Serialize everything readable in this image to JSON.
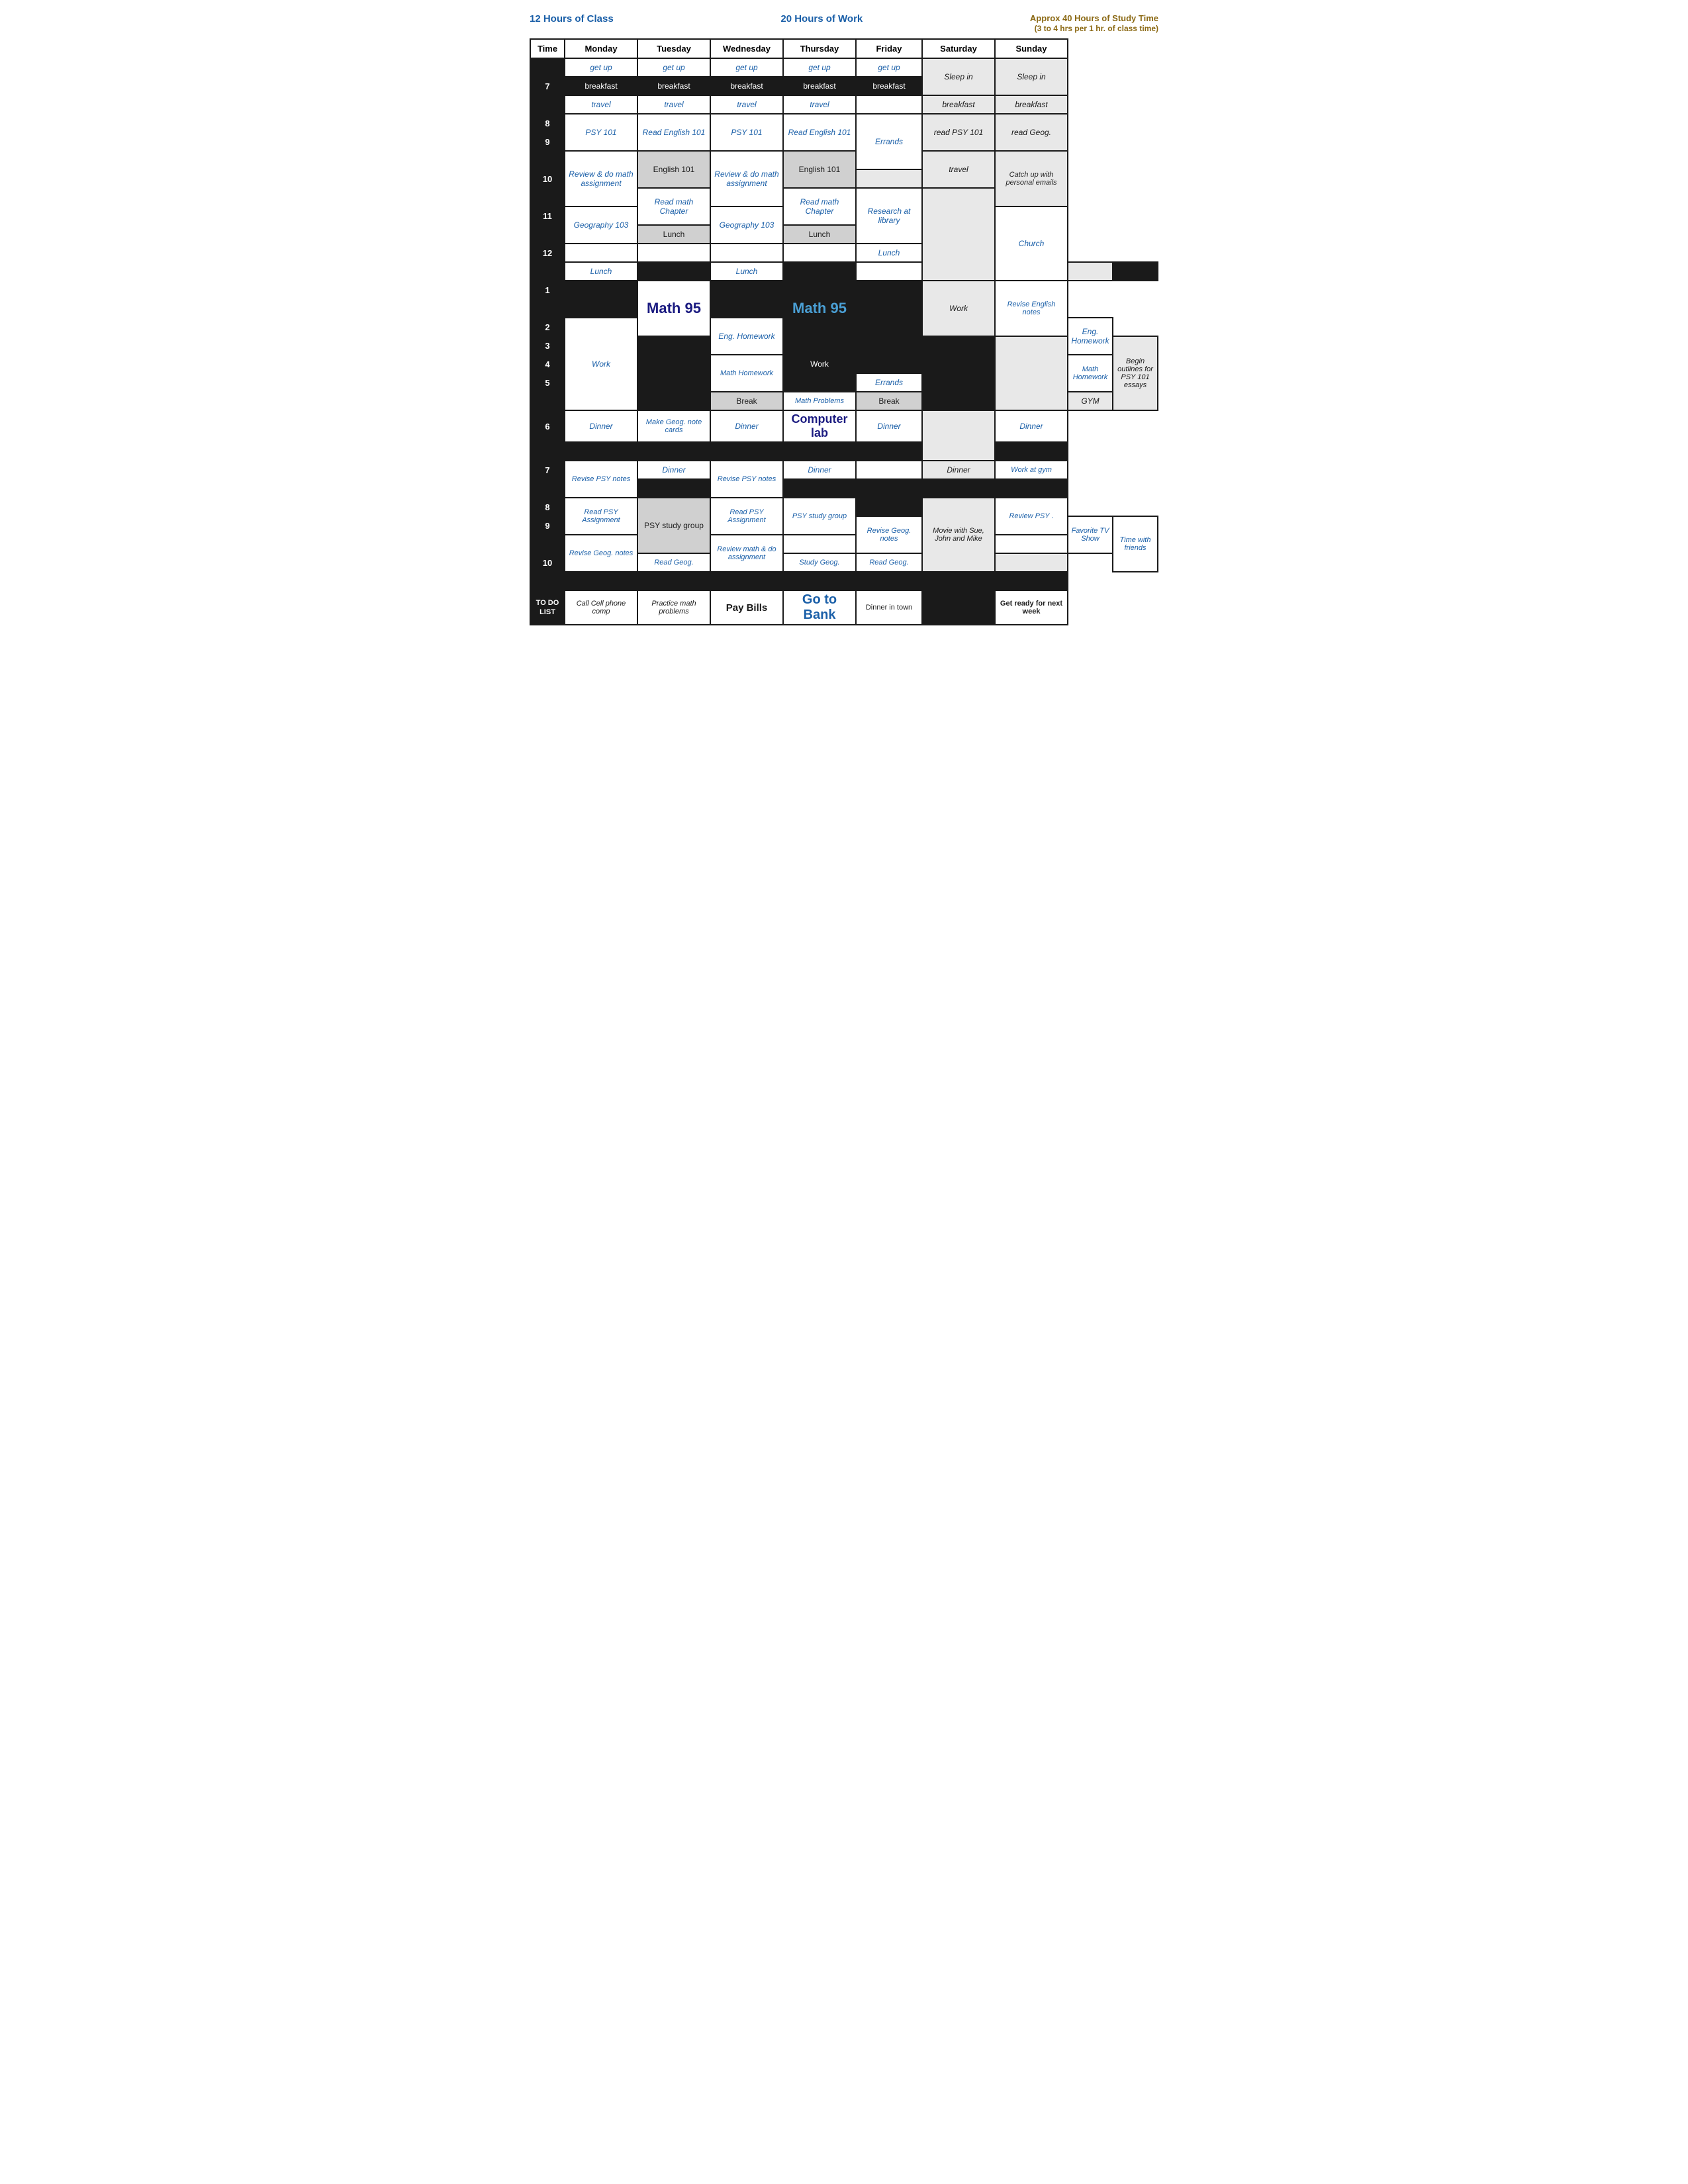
{
  "headers": {
    "left": "12 Hours of Class",
    "center": "20 Hours of Work",
    "right": "Approx 40 Hours of Study Time\n(3 to 4 hrs per 1 hr. of class time)"
  },
  "columns": [
    "Time",
    "Monday",
    "Tuesday",
    "Wednesday",
    "Thursday",
    "Friday",
    "Saturday",
    "Sunday"
  ],
  "todo": {
    "label": "TO DO\nLIST",
    "monday": "Call Cell phone comp",
    "tuesday": "Practice math problems",
    "wednesday": "Pay Bills",
    "thursday": "Go to\nBank",
    "friday": "Dinner in town",
    "saturday": "",
    "sunday": "Get ready for next week"
  }
}
